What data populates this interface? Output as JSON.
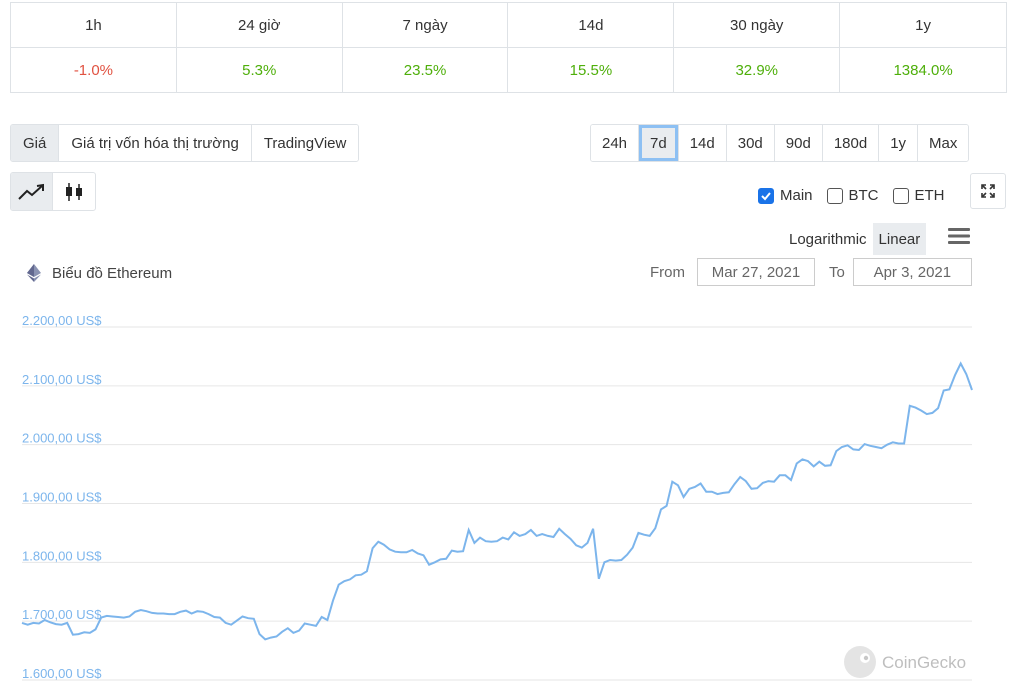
{
  "changes": {
    "headers": [
      "1h",
      "24 giờ",
      "7 ngày",
      "14d",
      "30 ngày",
      "1y"
    ],
    "values": [
      "-1.0%",
      "5.3%",
      "23.5%",
      "15.5%",
      "32.9%",
      "1384.0%"
    ]
  },
  "metric_tabs": [
    "Giá",
    "Giá trị vốn hóa thị trường",
    "TradingView"
  ],
  "range_tabs": [
    "24h",
    "7d",
    "14d",
    "30d",
    "90d",
    "180d",
    "1y",
    "Max"
  ],
  "range_selected": "7d",
  "compare": {
    "main": "Main",
    "btc": "BTC",
    "eth": "ETH"
  },
  "scale": {
    "log": "Logarithmic",
    "linear": "Linear"
  },
  "chart_title": "Biểu đồ Ethereum",
  "date_range": {
    "from_label": "From",
    "from": "Mar 27, 2021",
    "to_label": "To",
    "to": "Apr 3, 2021"
  },
  "watermark": "CoinGecko",
  "colors": {
    "line": "#7cb5ec",
    "negative": "#e15241",
    "positive": "#4eaf0a",
    "selected_outline": "#8dc0f3"
  },
  "chart_data": {
    "type": "line",
    "title": "Biểu đồ Ethereum",
    "xlim": [
      "Mar 27, 2021",
      "Apr 3, 2021"
    ],
    "ylim": [
      1600,
      2200
    ],
    "ytick_labels": [
      "2.200,00 US$",
      "2.100,00 US$",
      "2.000,00 US$",
      "1.900,00 US$",
      "1.800,00 US$",
      "1.700,00 US$",
      "1.600,00 US$"
    ],
    "yticks": [
      2200,
      2100,
      2000,
      1900,
      1800,
      1700,
      1600
    ],
    "grid": true,
    "series": [
      {
        "values": [
          1697,
          1694,
          1697,
          1696,
          1702,
          1698,
          1695,
          1694,
          1697,
          1677,
          1678,
          1681,
          1680,
          1686,
          1706,
          1709,
          1708,
          1707,
          1706,
          1708,
          1716,
          1719,
          1717,
          1714,
          1713,
          1713,
          1712,
          1712,
          1716,
          1718,
          1713,
          1717,
          1716,
          1712,
          1707,
          1706,
          1697,
          1694,
          1701,
          1708,
          1705,
          1704,
          1678,
          1669,
          1672,
          1674,
          1682,
          1688,
          1680,
          1684,
          1696,
          1694,
          1692,
          1707,
          1702,
          1735,
          1762,
          1768,
          1771,
          1778,
          1779,
          1785,
          1824,
          1835,
          1830,
          1822,
          1818,
          1817,
          1817,
          1821,
          1815,
          1812,
          1796,
          1800,
          1805,
          1806,
          1820,
          1818,
          1819,
          1855,
          1833,
          1842,
          1836,
          1835,
          1836,
          1842,
          1839,
          1851,
          1845,
          1848,
          1855,
          1845,
          1848,
          1845,
          1843,
          1857,
          1848,
          1840,
          1829,
          1825,
          1833,
          1857,
          1772,
          1800,
          1804,
          1803,
          1804,
          1813,
          1825,
          1850,
          1847,
          1845,
          1858,
          1890,
          1896,
          1937,
          1931,
          1911,
          1925,
          1928,
          1934,
          1920,
          1920,
          1916,
          1918,
          1919,
          1933,
          1945,
          1938,
          1925,
          1926,
          1935,
          1938,
          1937,
          1948,
          1948,
          1940,
          1968,
          1975,
          1972,
          1963,
          1971,
          1964,
          1965,
          1989,
          1996,
          1999,
          1992,
          1991,
          2001,
          1998,
          1996,
          1994,
          2000,
          2004,
          2002,
          2002,
          2066,
          2063,
          2058,
          2052,
          2054,
          2062,
          2092,
          2094,
          2118,
          2138,
          2120,
          2093
        ]
      }
    ]
  }
}
